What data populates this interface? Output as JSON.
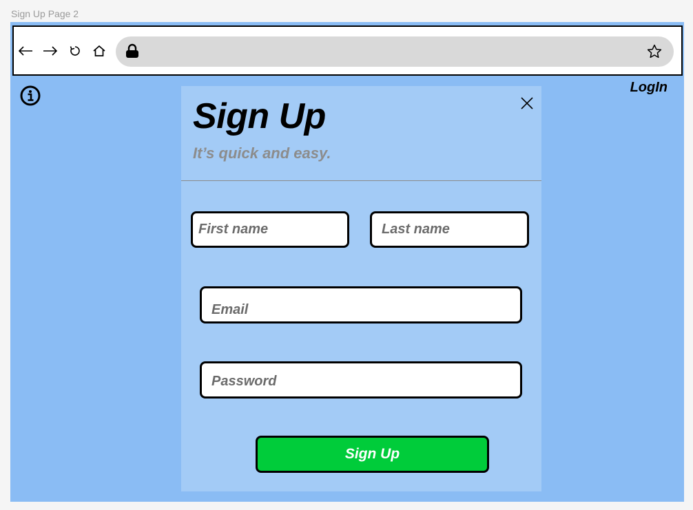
{
  "frame": {
    "label": "Sign Up Page 2"
  },
  "browser": {
    "nav_icons": [
      "back-arrow-icon",
      "forward-arrow-icon",
      "reload-icon",
      "home-icon"
    ],
    "url_icons": [
      "lock-icon",
      "star-icon"
    ]
  },
  "page": {
    "login_label": "LogIn",
    "info_icon": "info-icon"
  },
  "modal": {
    "title": "Sign Up",
    "subtitle": "It’s quick and easy.",
    "close_icon": "close-icon",
    "fields": {
      "first_name_placeholder": "First name",
      "last_name_placeholder": "Last name",
      "email_placeholder": "Email",
      "password_placeholder": "Password"
    },
    "submit_label": "Sign Up"
  },
  "colors": {
    "page_background": "#8abcf4",
    "modal_background": "#a3cbf6",
    "submit_button": "#00cc3a",
    "url_bar": "#d9d9d9",
    "subtitle_text": "#8c8c8c"
  }
}
